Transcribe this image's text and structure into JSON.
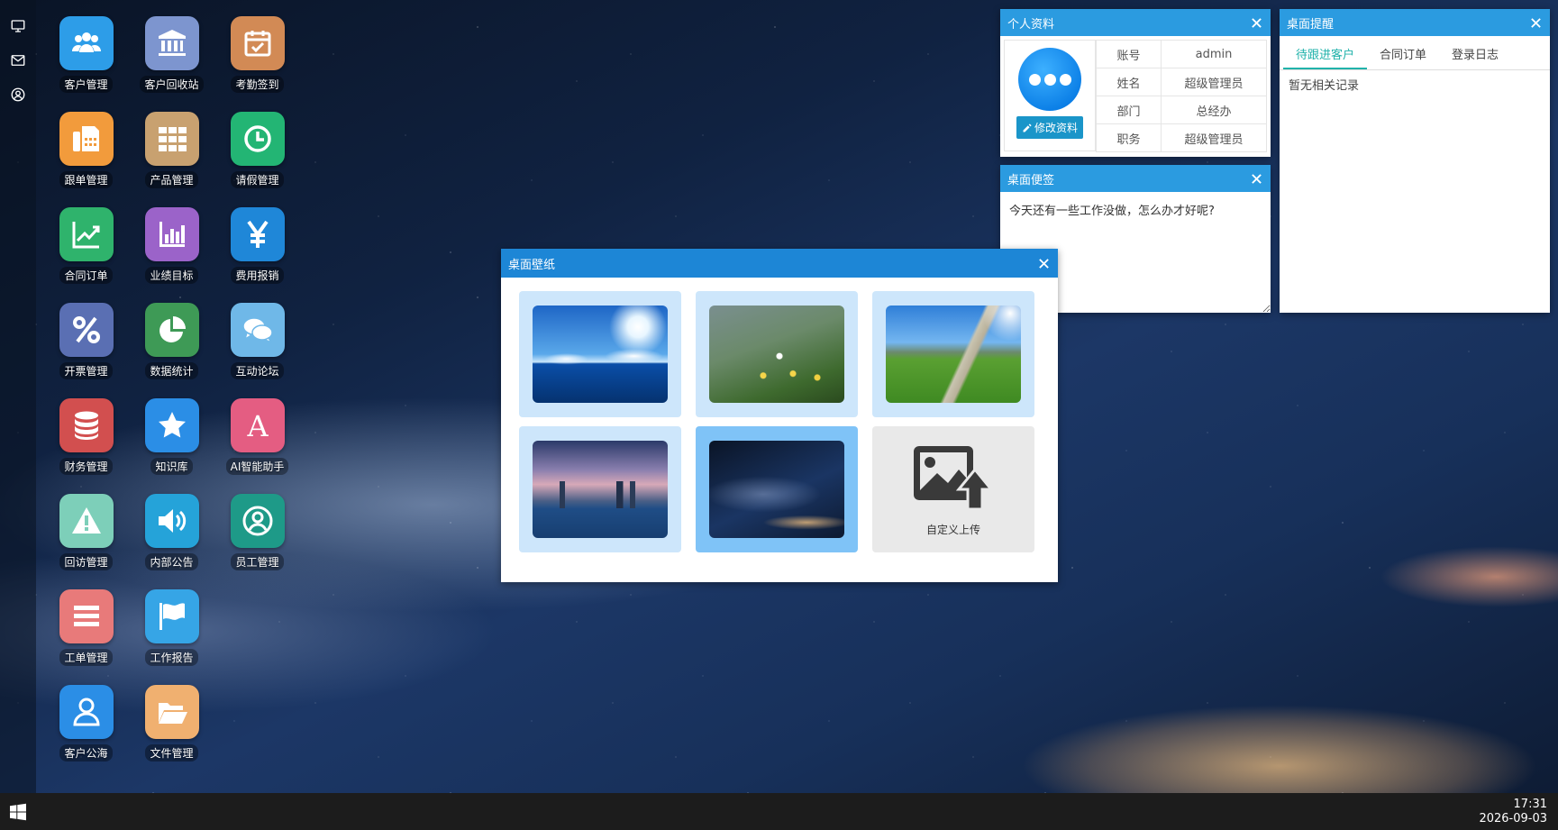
{
  "desktop": {
    "icons": [
      {
        "label": "客户管理",
        "icon": "users-icon",
        "color": "#2d9de8"
      },
      {
        "label": "客户回收站",
        "icon": "bank-icon",
        "color": "#7d95cf"
      },
      {
        "label": "考勤签到",
        "icon": "calendar-check-icon",
        "color": "#d28a55"
      },
      {
        "label": "跟单管理",
        "icon": "fax-icon",
        "color": "#f29b3c"
      },
      {
        "label": "产品管理",
        "icon": "grid-icon",
        "color": "#c8a170"
      },
      {
        "label": "请假管理",
        "icon": "clock-icon",
        "color": "#23b574"
      },
      {
        "label": "合同订单",
        "icon": "trend-chart-icon",
        "color": "#2fb36c"
      },
      {
        "label": "业绩目标",
        "icon": "bar-chart-icon",
        "color": "#9b63c9"
      },
      {
        "label": "费用报销",
        "icon": "yen-icon",
        "color": "#1f87d8"
      },
      {
        "label": "开票管理",
        "icon": "percent-icon",
        "color": "#5a6fb3"
      },
      {
        "label": "数据统计",
        "icon": "pie-chart-icon",
        "color": "#3e9a56"
      },
      {
        "label": "互动论坛",
        "icon": "chat-icon",
        "color": "#6fb8e8"
      },
      {
        "label": "财务管理",
        "icon": "database-icon",
        "color": "#d24f4f"
      },
      {
        "label": "知识库",
        "icon": "star-icon",
        "color": "#2b8ee6"
      },
      {
        "label": "AI智能助手",
        "icon": "letter-a-icon",
        "color": "#e45d82"
      },
      {
        "label": "回访管理",
        "icon": "warning-icon",
        "color": "#7dcfb9"
      },
      {
        "label": "内部公告",
        "icon": "speaker-icon",
        "color": "#25a3d9"
      },
      {
        "label": "员工管理",
        "icon": "user-circle-icon",
        "color": "#1e9a88"
      },
      {
        "label": "工单管理",
        "icon": "list-icon",
        "color": "#e87a7a"
      },
      {
        "label": "工作报告",
        "icon": "flag-icon",
        "color": "#36a5e6"
      },
      {
        "label": "",
        "icon": "",
        "color": ""
      },
      {
        "label": "客户公海",
        "icon": "user-outline-icon",
        "color": "#2b8ee6"
      },
      {
        "label": "文件管理",
        "icon": "folder-open-icon",
        "color": "#f0b070"
      }
    ]
  },
  "profile": {
    "title": "个人资料",
    "edit_label": "修改资料",
    "rows": [
      {
        "key": "账号",
        "value": "admin"
      },
      {
        "key": "姓名",
        "value": "超级管理员"
      },
      {
        "key": "部门",
        "value": "总经办"
      },
      {
        "key": "职务",
        "value": "超级管理员"
      }
    ]
  },
  "note": {
    "title": "桌面便签",
    "text": "今天还有一些工作没做，怎么办才好呢?"
  },
  "reminder": {
    "title": "桌面提醒",
    "tabs": [
      "待跟进客户",
      "合同订单",
      "登录日志"
    ],
    "active_tab": 0,
    "empty_text": "暂无相关记录"
  },
  "wallpaper": {
    "title": "桌面壁纸",
    "items": [
      "ocean-sky",
      "flowers-bokeh",
      "meadow-path",
      "city-skyline",
      "starry-night"
    ],
    "selected": "starry-night",
    "upload_label": "自定义上传"
  },
  "taskbar": {
    "time": "17:31",
    "date": "2026-09-03"
  },
  "colors": {
    "title_bar": "#2b9be0",
    "wallpaper_title_bar": "#1d86d6",
    "active_tab": "#20b2aa",
    "taskbar": "#1c1c1c"
  }
}
